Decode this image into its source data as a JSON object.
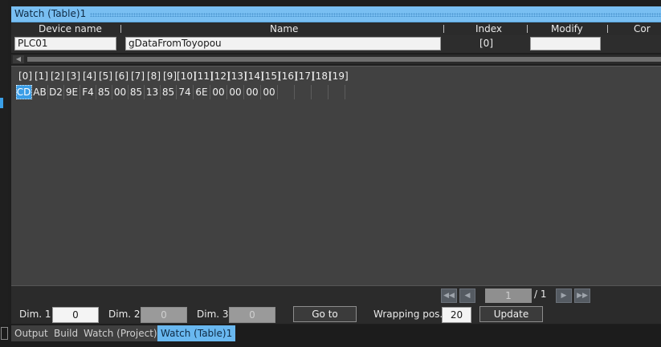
{
  "window": {
    "title": "Watch (Table)1"
  },
  "columns": {
    "device_name": "Device name",
    "name": "Name",
    "index": "Index",
    "modify": "Modify",
    "comment": "Cor"
  },
  "row": {
    "device": "PLC01",
    "name": "gDataFromToyopou",
    "index": "[0]",
    "modify": ""
  },
  "array": {
    "indices": [
      "[0]",
      "[1]",
      "[2]",
      "[3]",
      "[4]",
      "[5]",
      "[6]",
      "[7]",
      "[8]",
      "[9]",
      "[10]",
      "[11]",
      "[12]",
      "[13]",
      "[14]",
      "[15]",
      "[16]",
      "[17]",
      "[18]",
      "[19]"
    ],
    "values": [
      "CD",
      "AB",
      "D2",
      "9E",
      "F4",
      "85",
      "00",
      "85",
      "13",
      "85",
      "74",
      "6E",
      "00",
      "00",
      "00",
      "00",
      "",
      "",
      "",
      ""
    ],
    "selected_index": 0
  },
  "pager": {
    "current_page": "1",
    "total": "/ 1"
  },
  "controls": {
    "dim1_label": "Dim. 1",
    "dim1_value": "0",
    "dim2_label": "Dim. 2",
    "dim2_value": "0",
    "dim3_label": "Dim. 3",
    "dim3_value": "0",
    "goto_label": "Go to",
    "wrapping_label": "Wrapping pos.",
    "wrapping_value": "20",
    "update_label": "Update"
  },
  "tabs": [
    "Output",
    "Build",
    "Watch (Project)1",
    "Watch (Table)1"
  ],
  "active_tab": 3,
  "colors": {
    "accent": "#79bff2",
    "selection": "#3a9de6",
    "panel": "#414141"
  }
}
